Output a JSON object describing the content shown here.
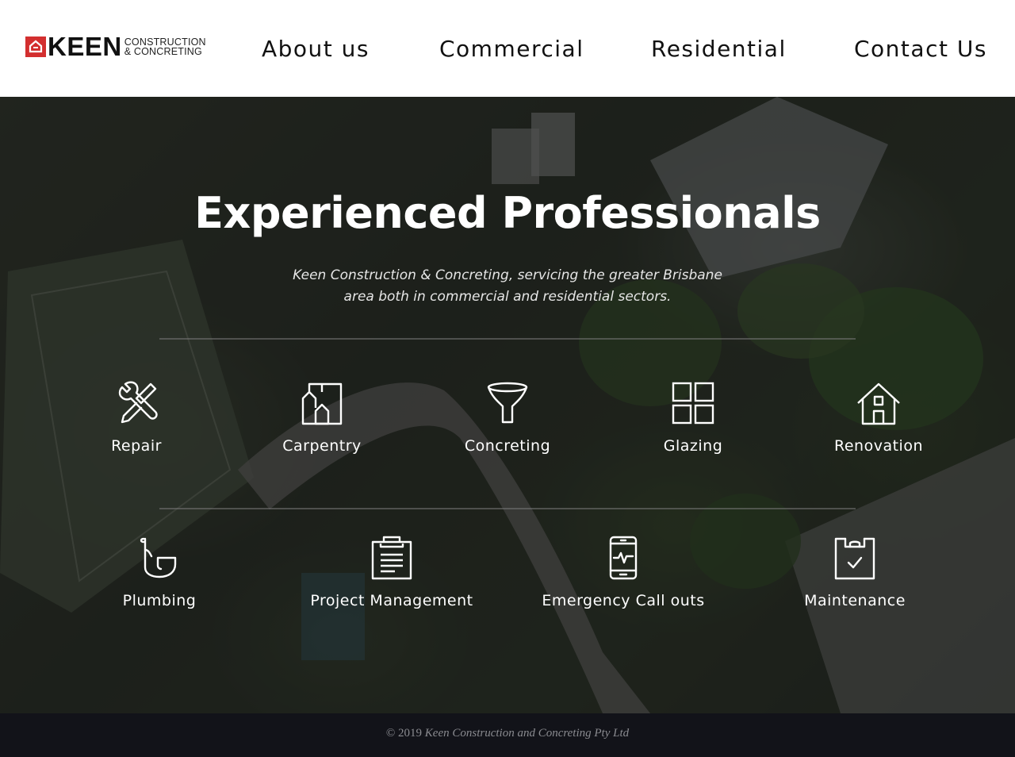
{
  "brand": {
    "name": "KEEN",
    "tagline_line1": "CONSTRUCTION",
    "tagline_line2": "& CONCRETING",
    "accent_color": "#d32f2f"
  },
  "nav": [
    {
      "label": "About us"
    },
    {
      "label": "Commercial"
    },
    {
      "label": "Residential"
    },
    {
      "label": "Contact Us"
    }
  ],
  "hero": {
    "title": "Experienced Professionals",
    "subtitle_line1": "Keen Construction & Concreting, servicing the greater Brisbane",
    "subtitle_line2": "area both in commercial and residential sectors."
  },
  "services_row1": [
    {
      "label": "Repair",
      "icon": "wrench-screwdriver-icon"
    },
    {
      "label": "Carpentry",
      "icon": "building-icon"
    },
    {
      "label": "Concreting",
      "icon": "funnel-icon"
    },
    {
      "label": "Glazing",
      "icon": "window-grid-icon"
    },
    {
      "label": "Renovation",
      "icon": "house-icon"
    }
  ],
  "services_row2": [
    {
      "label": "Plumbing",
      "icon": "pipe-icon"
    },
    {
      "label": "Project Management",
      "icon": "clipboard-list-icon"
    },
    {
      "label": "Emergency Call outs",
      "icon": "mobile-pulse-icon"
    },
    {
      "label": "Maintenance",
      "icon": "clipboard-check-icon"
    }
  ],
  "footer": {
    "copyright": "© 2019",
    "company": "Keen Construction and Concreting Pty Ltd"
  }
}
